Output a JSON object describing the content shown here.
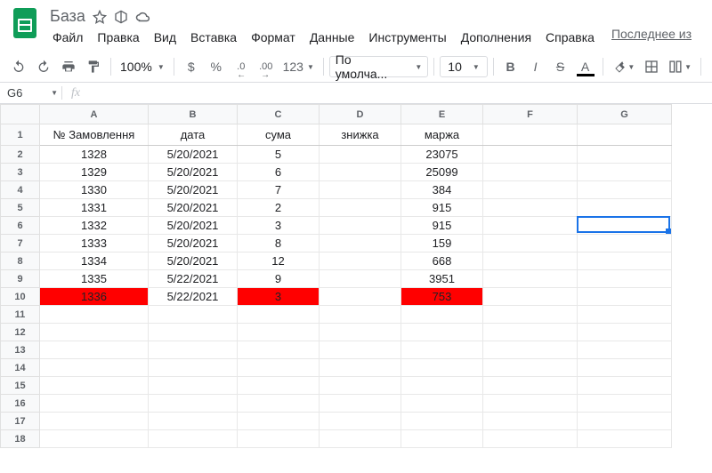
{
  "doc": {
    "title": "База",
    "last_edit": "Последнее из"
  },
  "menu": {
    "file": "Файл",
    "edit": "Правка",
    "view": "Вид",
    "insert": "Вставка",
    "format": "Формат",
    "data": "Данные",
    "tools": "Инструменты",
    "addons": "Дополнения",
    "help": "Справка"
  },
  "toolbar": {
    "zoom": "100%",
    "currency": "$",
    "percent": "%",
    "dec_dec": ".0←",
    "dec_inc": ".00→",
    "more_fmt": "123",
    "font": "По умолча...",
    "size": "10",
    "bold": "B",
    "italic": "I",
    "strike": "S",
    "color": "A"
  },
  "namebox": {
    "ref": "G6"
  },
  "columns": [
    "A",
    "B",
    "C",
    "D",
    "E",
    "F",
    "G"
  ],
  "headers": {
    "A": "№ Замовлення",
    "B": "дата",
    "C": "сума",
    "D": "знижка",
    "E": "маржа"
  },
  "rows": [
    {
      "n": 2,
      "A": "1328",
      "B": "5/20/2021",
      "C": "5",
      "D": "",
      "E": "23075",
      "hl": false
    },
    {
      "n": 3,
      "A": "1329",
      "B": "5/20/2021",
      "C": "6",
      "D": "",
      "E": "25099",
      "hl": false
    },
    {
      "n": 4,
      "A": "1330",
      "B": "5/20/2021",
      "C": "7",
      "D": "",
      "E": "384",
      "hl": false
    },
    {
      "n": 5,
      "A": "1331",
      "B": "5/20/2021",
      "C": "2",
      "D": "",
      "E": "915",
      "hl": false
    },
    {
      "n": 6,
      "A": "1332",
      "B": "5/20/2021",
      "C": "3",
      "D": "",
      "E": "915",
      "hl": false
    },
    {
      "n": 7,
      "A": "1333",
      "B": "5/20/2021",
      "C": "8",
      "D": "",
      "E": "159",
      "hl": false
    },
    {
      "n": 8,
      "A": "1334",
      "B": "5/20/2021",
      "C": "12",
      "D": "",
      "E": "668",
      "hl": false
    },
    {
      "n": 9,
      "A": "1335",
      "B": "5/22/2021",
      "C": "9",
      "D": "",
      "E": "3951",
      "hl": false
    },
    {
      "n": 10,
      "A": "1336",
      "B": "5/22/2021",
      "C": "3",
      "D": "",
      "E": "753",
      "hl": true
    }
  ],
  "empty_rows": [
    11,
    12,
    13,
    14,
    15,
    16,
    17,
    18
  ],
  "selection": {
    "ref": "G6"
  },
  "colors": {
    "highlight": "#ff0000",
    "selection": "#1a73e8"
  }
}
